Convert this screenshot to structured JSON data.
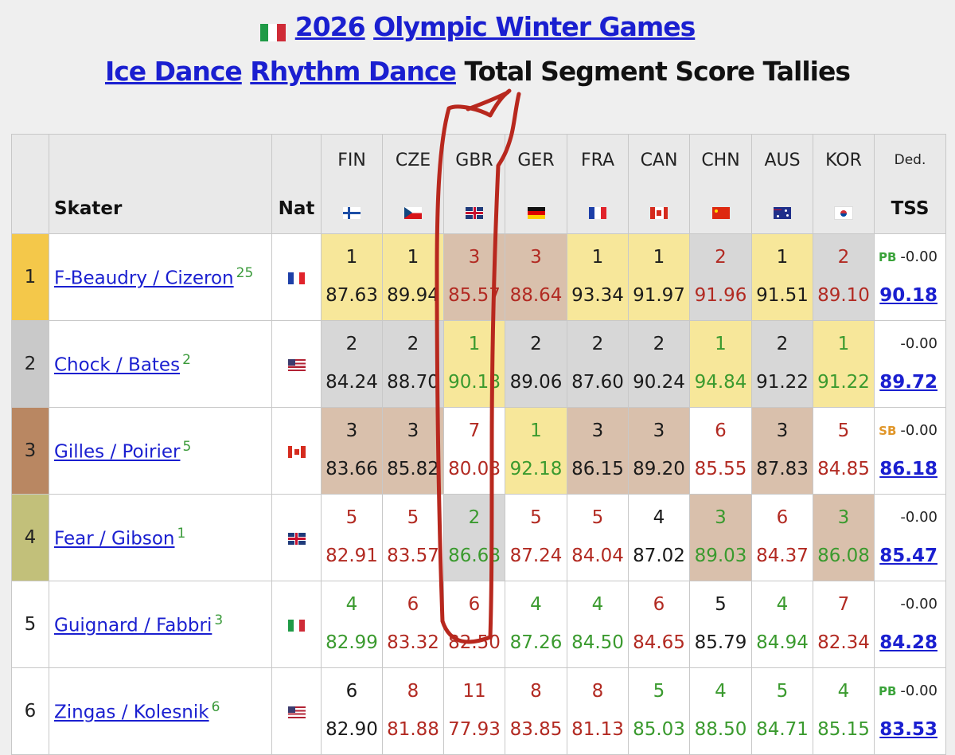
{
  "title": {
    "flag_icon": "italy-flag-icon",
    "year": "2026",
    "games": "Olympic Winter Games",
    "discipline": "Ice Dance",
    "segment": "Rhythm Dance",
    "rest": "Total Segment Score Tallies"
  },
  "table": {
    "skater_header": "Skater",
    "nat_header": "Nat",
    "ded_header": "Ded.",
    "tss_header": "TSS",
    "judges": [
      {
        "code": "FIN",
        "flag": "finland-flag-icon"
      },
      {
        "code": "CZE",
        "flag": "czech-flag-icon"
      },
      {
        "code": "GBR",
        "flag": "uk-flag-icon"
      },
      {
        "code": "GER",
        "flag": "germany-flag-icon"
      },
      {
        "code": "FRA",
        "flag": "france-flag-icon"
      },
      {
        "code": "CAN",
        "flag": "canada-flag-icon"
      },
      {
        "code": "CHN",
        "flag": "china-flag-icon"
      },
      {
        "code": "AUS",
        "flag": "australia-flag-icon"
      },
      {
        "code": "KOR",
        "flag": "korea-flag-icon"
      }
    ],
    "rows": [
      {
        "rank": "1",
        "skater": "F-Beaudry / Cizeron",
        "sup": "25",
        "nat": "france-flag-icon",
        "tag": "PB",
        "ded": "-0.00",
        "tss": "90.18",
        "cells": [
          [
            "1",
            "87.63"
          ],
          [
            "1",
            "89.94"
          ],
          [
            "3",
            "85.57"
          ],
          [
            "3",
            "88.64"
          ],
          [
            "1",
            "93.34"
          ],
          [
            "1",
            "91.97"
          ],
          [
            "2",
            "91.96"
          ],
          [
            "1",
            "91.51"
          ],
          [
            "2",
            "89.10"
          ]
        ]
      },
      {
        "rank": "2",
        "skater": "Chock / Bates",
        "sup": "2",
        "nat": "usa-flag-icon",
        "tag": "",
        "ded": "-0.00",
        "tss": "89.72",
        "cells": [
          [
            "2",
            "84.24"
          ],
          [
            "2",
            "88.70"
          ],
          [
            "1",
            "90.18"
          ],
          [
            "2",
            "89.06"
          ],
          [
            "2",
            "87.60"
          ],
          [
            "2",
            "90.24"
          ],
          [
            "1",
            "94.84"
          ],
          [
            "2",
            "91.22"
          ],
          [
            "1",
            "91.22"
          ]
        ]
      },
      {
        "rank": "3",
        "skater": "Gilles / Poirier",
        "sup": "5",
        "nat": "canada-flag-icon",
        "tag": "SB",
        "ded": "-0.00",
        "tss": "86.18",
        "cells": [
          [
            "3",
            "83.66"
          ],
          [
            "3",
            "85.82"
          ],
          [
            "7",
            "80.08"
          ],
          [
            "1",
            "92.18"
          ],
          [
            "3",
            "86.15"
          ],
          [
            "3",
            "89.20"
          ],
          [
            "6",
            "85.55"
          ],
          [
            "3",
            "87.83"
          ],
          [
            "5",
            "84.85"
          ]
        ]
      },
      {
        "rank": "4",
        "skater": "Fear / Gibson",
        "sup": "1",
        "nat": "uk-flag-icon",
        "tag": "",
        "ded": "-0.00",
        "tss": "85.47",
        "cells": [
          [
            "5",
            "82.91"
          ],
          [
            "5",
            "83.57"
          ],
          [
            "2",
            "86.68"
          ],
          [
            "5",
            "87.24"
          ],
          [
            "5",
            "84.04"
          ],
          [
            "4",
            "87.02"
          ],
          [
            "3",
            "89.03"
          ],
          [
            "6",
            "84.37"
          ],
          [
            "3",
            "86.08"
          ]
        ]
      },
      {
        "rank": "5",
        "skater": "Guignard / Fabbri",
        "sup": "3",
        "nat": "italy-flag-icon",
        "tag": "",
        "ded": "-0.00",
        "tss": "84.28",
        "cells": [
          [
            "4",
            "82.99"
          ],
          [
            "6",
            "83.32"
          ],
          [
            "6",
            "82.50"
          ],
          [
            "4",
            "87.26"
          ],
          [
            "4",
            "84.50"
          ],
          [
            "6",
            "84.65"
          ],
          [
            "5",
            "85.79"
          ],
          [
            "4",
            "84.94"
          ],
          [
            "7",
            "82.34"
          ]
        ]
      },
      {
        "rank": "6",
        "skater": "Zingas / Kolesnik",
        "sup": "6",
        "nat": "usa-flag-icon",
        "tag": "PB",
        "ded": "-0.00",
        "tss": "83.53",
        "cells": [
          [
            "6",
            "82.90"
          ],
          [
            "8",
            "81.88"
          ],
          [
            "11",
            "77.93"
          ],
          [
            "8",
            "83.85"
          ],
          [
            "8",
            "81.13"
          ],
          [
            "5",
            "85.03"
          ],
          [
            "4",
            "88.50"
          ],
          [
            "5",
            "84.71"
          ],
          [
            "4",
            "85.15"
          ]
        ]
      }
    ]
  },
  "colors": {
    "link": "#1a1fd0",
    "gold": "#f7e79a",
    "silver": "#d7d7d7",
    "bronze": "#d9c0ac",
    "better": "#3a9a2e",
    "worse": "#b22a22",
    "annotation": "#b8281e"
  }
}
